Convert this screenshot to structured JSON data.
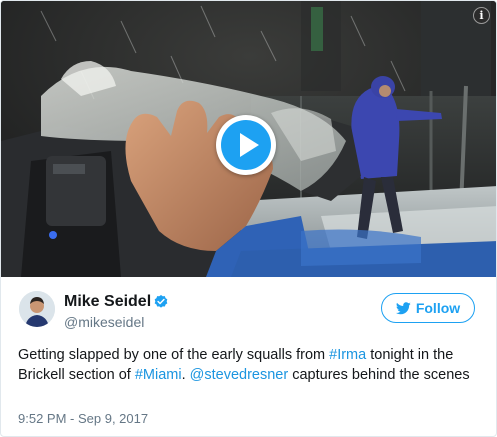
{
  "media": {
    "info_icon": "info-icon",
    "play_icon": "play-icon",
    "accent_color": "#1da1f2"
  },
  "author": {
    "name": "Mike Seidel",
    "handle": "@mikeseidel",
    "verified": true,
    "avatar_icon": "avatar"
  },
  "follow_button": {
    "label": "Follow",
    "icon": "twitter-bird-icon",
    "color": "#1da1f2"
  },
  "tweet": {
    "text_1": "Getting slapped by one of the early squalls from ",
    "hashtag_irma": "#Irma",
    "text_2": " tonight in the Brickell section of ",
    "hashtag_miami": "#Miami",
    "text_3": ". ",
    "mention": "@stevedresner",
    "text_4": " captures behind the scenes",
    "link_color": "#1b95e0"
  },
  "timestamp": "9:52 PM - Sep 9, 2017"
}
